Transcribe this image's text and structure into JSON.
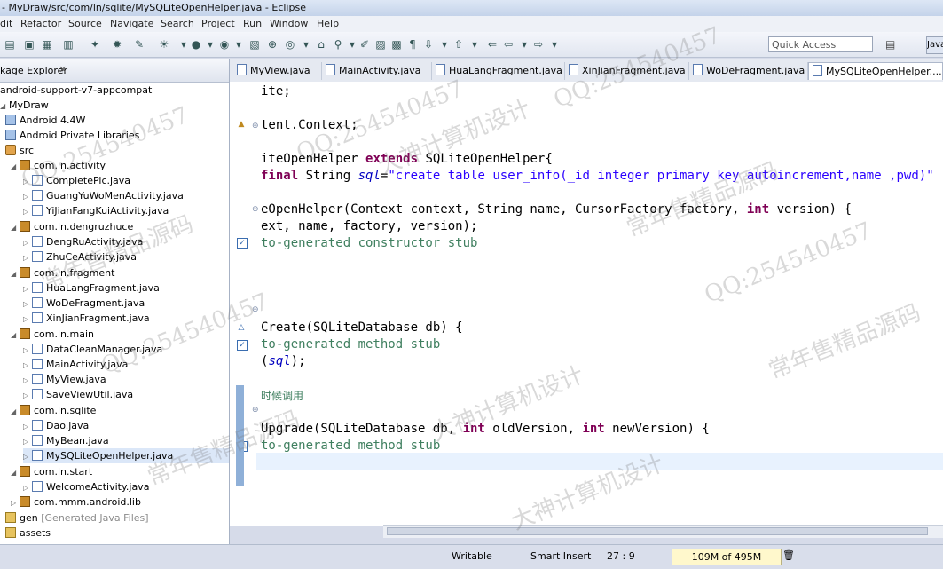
{
  "window": {
    "title": "- MyDraw/src/com/ln/sqlite/MySQLiteOpenHelper.java - Eclipse"
  },
  "menu": [
    "dit",
    "Refactor",
    "Source",
    "Navigate",
    "Search",
    "Project",
    "Run",
    "Window",
    "Help"
  ],
  "quick_access": {
    "placeholder": "Quick Access"
  },
  "perspective": {
    "label": "Java"
  },
  "explorer": {
    "title": "kage Explorer",
    "items": [
      {
        "label": "android-support-v7-appcompat"
      },
      {
        "label": "MyDraw"
      },
      {
        "label": "Android 4.4W"
      },
      {
        "label": "Android Private Libraries"
      },
      {
        "label": "src"
      },
      {
        "label": "com.ln.activity"
      },
      {
        "label": "CompletePic.java"
      },
      {
        "label": "GuangYuWoMenActivity.java"
      },
      {
        "label": "YiJianFangKuiActivity.java"
      },
      {
        "label": "com.ln.dengruzhuce"
      },
      {
        "label": "DengRuActivity.java"
      },
      {
        "label": "ZhuCeActivity.java"
      },
      {
        "label": "com.ln.fragment"
      },
      {
        "label": "HuaLangFragment.java"
      },
      {
        "label": "WoDeFragment.java"
      },
      {
        "label": "XinJianFragment.java"
      },
      {
        "label": "com.ln.main"
      },
      {
        "label": "DataCleanManager.java"
      },
      {
        "label": "MainActivity.java"
      },
      {
        "label": "MyView.java"
      },
      {
        "label": "SaveViewUtil.java"
      },
      {
        "label": "com.ln.sqlite"
      },
      {
        "label": "Dao.java"
      },
      {
        "label": "MyBean.java"
      },
      {
        "label": "MySQLiteOpenHelper.java"
      },
      {
        "label": "com.ln.start"
      },
      {
        "label": "WelcomeActivity.java"
      },
      {
        "label": "com.mmm.android.lib"
      },
      {
        "label": "gen",
        "extra": "[Generated Java Files]"
      },
      {
        "label": "assets"
      }
    ]
  },
  "editor_tabs": [
    "MyView.java",
    "MainActivity.java",
    "HuaLangFragment.java",
    "XinJianFragment.java",
    "WoDeFragment.java",
    "MySQLiteOpenHelper...."
  ],
  "code": {
    "l1": "ite;",
    "l2": "tent.Context;",
    "l3a": "iteOpenHelper ",
    "l3kw": "extends",
    "l3b": " SQLiteOpenHelper{",
    "l4kw": "final",
    "l4a": " String ",
    "l4var": "sql",
    "l4b": "=",
    "l4str": "\"create table user_info(_id integer primary key autoincrement,name ,pwd)\"",
    "l5a": "eOpenHelper(Context context, String name, CursorFactory factory, ",
    "l5kw": "int",
    "l5b": " version) {",
    "l6": "ext, name, factory, version);",
    "l7": "to-generated constructor stub",
    "l8": "Create(SQLiteDatabase db) {",
    "l9": "to-generated method stub",
    "l10a": "(",
    "l10var": "sql",
    "l10b": ");",
    "l11": "时候调用",
    "l12a": "Upgrade(SQLiteDatabase db, ",
    "l12kw1": "int",
    "l12b": " oldVersion, ",
    "l12kw2": "int",
    "l12c": " newVersion) {",
    "l13": "to-generated method stub"
  },
  "status": {
    "writable": "Writable",
    "insert_mode": "Smart Insert",
    "position": "27 : 9",
    "heap": "109M of 495M"
  },
  "watermarks": [
    "QQ:254540457",
    "常年售精品源码",
    "大神计算机设计",
    "QQ:254540457",
    "常年售精品源码",
    "大神计算机设计",
    "QQ:254540457",
    "常年售精品源码",
    "QQ:254540457",
    "大神计算机设计",
    "QQ:254540457",
    "常年售精品源码"
  ]
}
